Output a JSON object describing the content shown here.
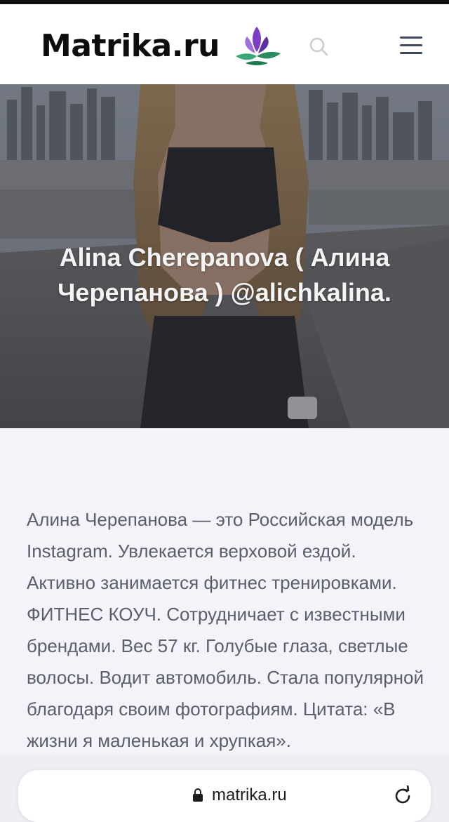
{
  "header": {
    "logo_text": "Matrika.ru",
    "logo_icon": "lotus-logo-icon",
    "search_icon": "search-icon",
    "menu_icon": "hamburger-menu-icon"
  },
  "hero": {
    "title": "Alina Cherepanova ( Алина Черепанова ) @alichkalina.",
    "image": "photo-of-woman-on-rooftop"
  },
  "article": {
    "text": "Алина Черепанова — это Российская модель Instagram. Увлекается верховой ездой. Активно занимается фитнес тренировками. ФИТНЕС КОУЧ. Сотрудничает с известными брендами. Вес 57 кг. Голубые глаза, светлые волосы. Водит автомобиль. Стала популярной благодаря своим фотографиям. Цитата: «В жизни я маленькая и хрупкая»."
  },
  "browser": {
    "url": "matrika.ru",
    "lock_icon": "lock-icon",
    "reload_icon": "reload-icon"
  },
  "colors": {
    "accent_purple": "#7b3fc4",
    "accent_green": "#2fa36b",
    "text_gray": "#5a5f6b",
    "header_bg": "#ffffff",
    "page_bg": "#f3f3f9"
  }
}
